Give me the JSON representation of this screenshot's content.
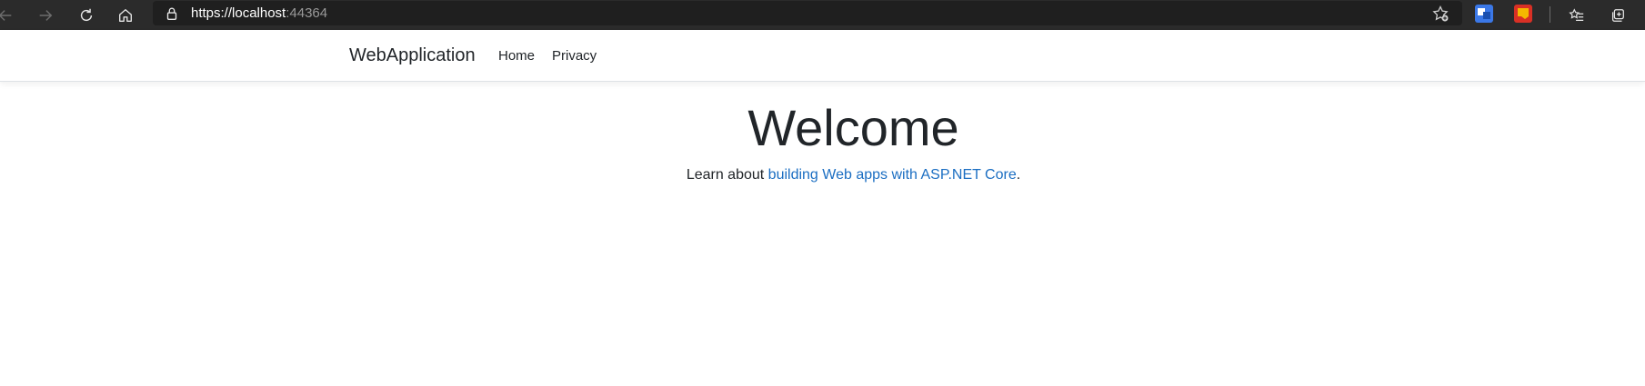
{
  "browser": {
    "url_main": "https://localhost",
    "url_port": ":44364",
    "icons": {
      "back": "back-arrow-icon",
      "forward": "forward-arrow-icon",
      "refresh": "refresh-icon",
      "home": "home-icon",
      "lock": "lock-icon",
      "add_favorite": "star-add-icon",
      "translate_ext": "translate-icon",
      "extension": "extension-icon",
      "favorites": "favorites-list-icon",
      "collections": "collections-icon"
    }
  },
  "navbar": {
    "brand": "WebApplication",
    "links": [
      "Home",
      "Privacy"
    ]
  },
  "main": {
    "title": "Welcome",
    "text_prefix": "Learn about ",
    "link_text": "building Web apps with ASP.NET Core",
    "text_suffix": "."
  },
  "colors": {
    "chrome_bg": "#2b2b2b",
    "link": "#1b6ec2",
    "text": "#212529"
  }
}
